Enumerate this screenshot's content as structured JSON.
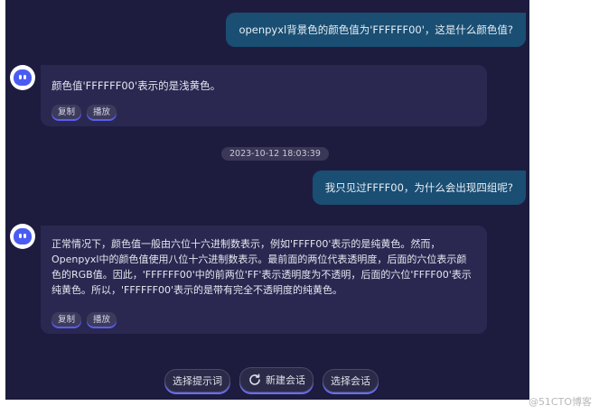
{
  "messages": {
    "user1": "openpyxl背景色的颜色值为'FFFFFF00'，这是什么颜色值?",
    "bot1": "颜色值'FFFFFF00'表示的是浅黄色。",
    "timestamp": "2023-10-12 18:03:39",
    "user2": "我只见过FFFF00，为什么会出现四组呢?",
    "bot2_lines": [
      "正常情况下，颜色值一般由六位十六进制数表示，例如'FFFF00'表示的是纯黄色。然而，",
      "Openpyxl中的颜色值使用八位十六进制数表示。最前面的两位代表透明度，后面的六位表示颜",
      "色的RGB值。因此，'FFFFFF00'中的前两位'FF'表示透明度为不透明，后面的六位'FFFF00'表示",
      "纯黄色。所以，'FFFFFF00'表示的是带有完全不透明度的纯黄色。"
    ]
  },
  "actions": {
    "copy": "复制",
    "play": "播放"
  },
  "bottom_bar": {
    "select_prompt": "选择提示词",
    "new_chat": "新建会话",
    "select_chat": "选择会话"
  },
  "watermark": "@51CTO博客",
  "colors": {
    "background": "#1d1c3f",
    "user_bubble": "#1a4e72",
    "bot_bubble": "#2a2850",
    "accent": "#5a5ef0"
  }
}
